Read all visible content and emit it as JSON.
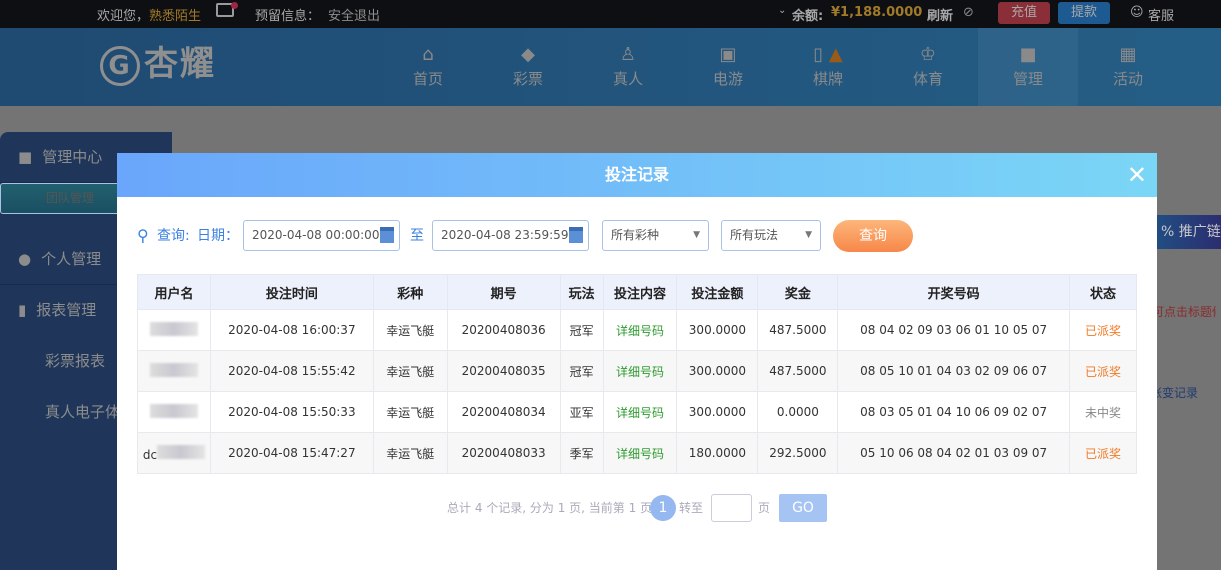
{
  "topbar": {
    "welcome": "欢迎您，",
    "username": "熟悉陌生",
    "reserved_info": "预留信息：",
    "logout": "安全退出",
    "balance_label": "余额:",
    "balance": "¥1,188.0000",
    "refresh": "刷新",
    "deposit": "充值",
    "withdraw": "提款",
    "service": "客服"
  },
  "header": {
    "logo": "杏耀",
    "nav": [
      "首页",
      "彩票",
      "真人",
      "电游",
      "棋牌",
      "体育",
      "管理",
      "活动"
    ]
  },
  "sidebar": {
    "items": [
      "管理中心",
      "团队管理",
      "个人管理",
      "报表管理",
      "彩票报表",
      "真人电子体"
    ]
  },
  "right_panel": {
    "promo": "推广链接",
    "hint": "可点击标题修",
    "record": "账变记录"
  },
  "modal": {
    "title": "投注记录",
    "query_label": "查询:",
    "date_label": "日期：",
    "start_date": "2020-04-08 00:00:00",
    "to": "至",
    "end_date": "2020-04-08 23:59:59",
    "lottery_select": "所有彩种",
    "play_select": "所有玩法",
    "query_button": "查询",
    "columns": [
      "用户名",
      "投注时间",
      "彩种",
      "期号",
      "玩法",
      "投注内容",
      "投注金额",
      "奖金",
      "开奖号码",
      "状态"
    ],
    "rows": [
      {
        "user": "",
        "time": "2020-04-08 16:00:37",
        "lottery": "幸运飞艇",
        "issue": "20200408036",
        "play": "冠军",
        "content": "详细号码",
        "amount": "300.0000",
        "prize": "487.5000",
        "numbers": "08 04 02 09 03 06 01 10 05 07",
        "status": "已派奖"
      },
      {
        "user": "",
        "time": "2020-04-08 15:55:42",
        "lottery": "幸运飞艇",
        "issue": "20200408035",
        "play": "冠军",
        "content": "详细号码",
        "amount": "300.0000",
        "prize": "487.5000",
        "numbers": "08 05 10 01 04 03 02 09 06 07",
        "status": "已派奖"
      },
      {
        "user": "",
        "time": "2020-04-08 15:50:33",
        "lottery": "幸运飞艇",
        "issue": "20200408034",
        "play": "亚军",
        "content": "详细号码",
        "amount": "300.0000",
        "prize": "0.0000",
        "numbers": "08 03 05 01 04 10 06 09 02 07",
        "status": "未中奖"
      },
      {
        "user": "dc",
        "time": "2020-04-08 15:47:27",
        "lottery": "幸运飞艇",
        "issue": "20200408033",
        "play": "季军",
        "content": "详细号码",
        "amount": "180.0000",
        "prize": "292.5000",
        "numbers": "05 10 06 08 04 02 01 03 09 07",
        "status": "已派奖"
      }
    ],
    "pager": {
      "summary": "总计 4 个记录, 分为 1 页, 当前第 1 页",
      "current": "1",
      "goto": "转至",
      "page": "页",
      "go": "GO"
    }
  }
}
